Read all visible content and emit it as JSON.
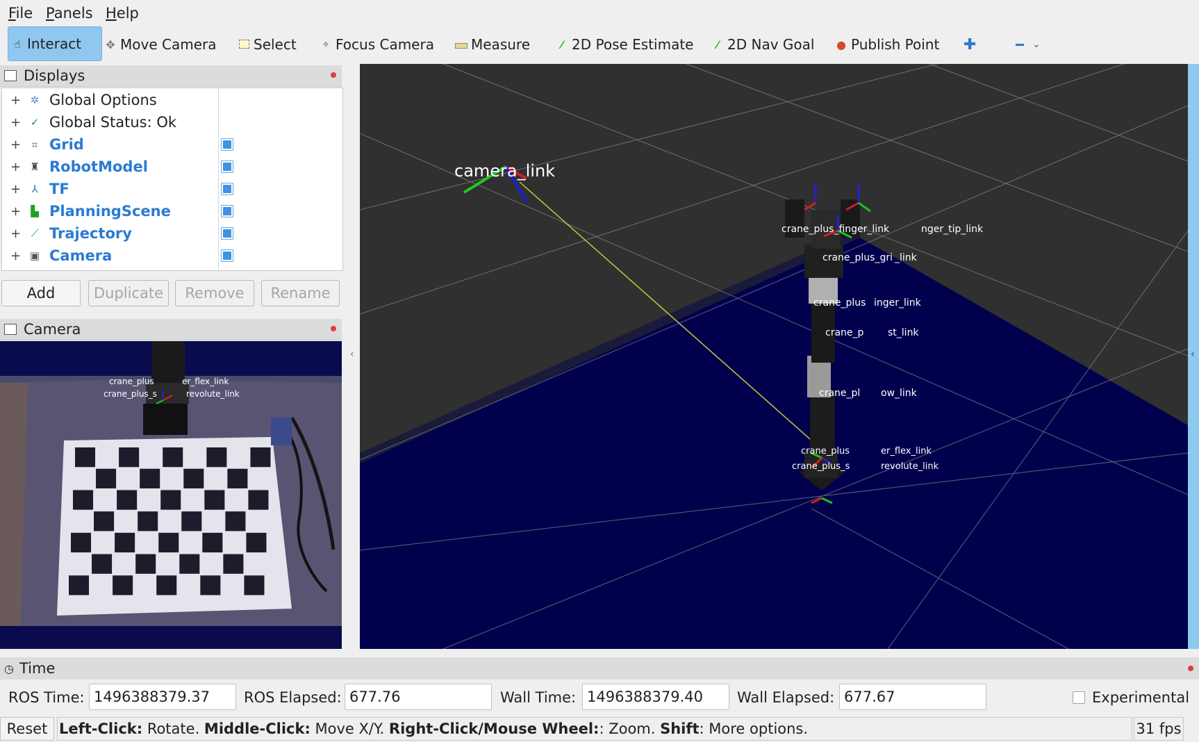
{
  "menu": {
    "file": {
      "accel": "F",
      "rest": "ile"
    },
    "panels": {
      "accel": "P",
      "rest": "anels"
    },
    "help": {
      "accel": "H",
      "rest": "elp"
    }
  },
  "toolbar": {
    "interact": "Interact",
    "move_camera": "Move Camera",
    "select": "Select",
    "focus_camera": "Focus Camera",
    "measure": "Measure",
    "pose_estimate": "2D Pose Estimate",
    "nav_goal": "2D Nav Goal",
    "publish_point": "Publish Point"
  },
  "displays": {
    "title": "Displays",
    "items": [
      {
        "label": "Global Options",
        "icon": "gear-icon",
        "enabled": null
      },
      {
        "label": "Global Status: Ok",
        "icon": "check-icon",
        "enabled": null
      },
      {
        "label": "Grid",
        "icon": "grid-icon",
        "enabled": true
      },
      {
        "label": "RobotModel",
        "icon": "robot-icon",
        "enabled": true
      },
      {
        "label": "TF",
        "icon": "axes-icon",
        "enabled": true
      },
      {
        "label": "PlanningScene",
        "icon": "planning-scene-icon",
        "enabled": true
      },
      {
        "label": "Trajectory",
        "icon": "trajectory-icon",
        "enabled": true
      },
      {
        "label": "Camera",
        "icon": "camera-icon",
        "enabled": true
      }
    ],
    "buttons": {
      "add": "Add",
      "duplicate": "Duplicate",
      "remove": "Remove",
      "rename": "Rename"
    }
  },
  "camera_panel": {
    "title": "Camera",
    "overlay_labels": [
      "crane_plus",
      "er_flex_link",
      "crane_plus_s",
      "revolute_link"
    ]
  },
  "view3d": {
    "frame_labels": {
      "camera_link": "camera_link",
      "tip_left": "crane_plus_finger_link",
      "tip_right": "nger_tip_link",
      "gripper": "crane_plus_gri",
      "gripper_suffix": "_link",
      "moving_finger": "crane_plus",
      "moving_finger_suffix": "inger_link",
      "wrist": "crane_p",
      "wrist_suffix": "st_link",
      "elbow": "crane_pl",
      "elbow_suffix": "ow_link",
      "shoulder_flex": "crane_plus",
      "shoulder_flex_suffix": "er_flex_link",
      "shoulder_rev": "crane_plus_s",
      "shoulder_rev_suffix": "revolute_link"
    }
  },
  "time": {
    "title": "Time",
    "ros_time_label": "ROS Time:",
    "ros_time": "1496388379.37",
    "ros_elapsed_label": "ROS Elapsed:",
    "ros_elapsed": "677.76",
    "wall_time_label": "Wall Time:",
    "wall_time": "1496388379.40",
    "wall_elapsed_label": "Wall Elapsed:",
    "wall_elapsed": "677.67",
    "experimental": "Experimental"
  },
  "status": {
    "reset": "Reset",
    "help": {
      "left_click": "Left-Click:",
      "left_click_desc": " Rotate. ",
      "middle_click": "Middle-Click:",
      "middle_click_desc": " Move X/Y. ",
      "right_click": "Right-Click/Mouse Wheel:",
      "right_click_desc": ": Zoom. ",
      "shift": "Shift",
      "shift_desc": ": More options."
    },
    "fps": "31 fps"
  },
  "colors": {
    "accent": "#2a7bd1",
    "active_tool": "#8fc7ee",
    "floor": "#00004d",
    "view_bg": "#303030"
  }
}
